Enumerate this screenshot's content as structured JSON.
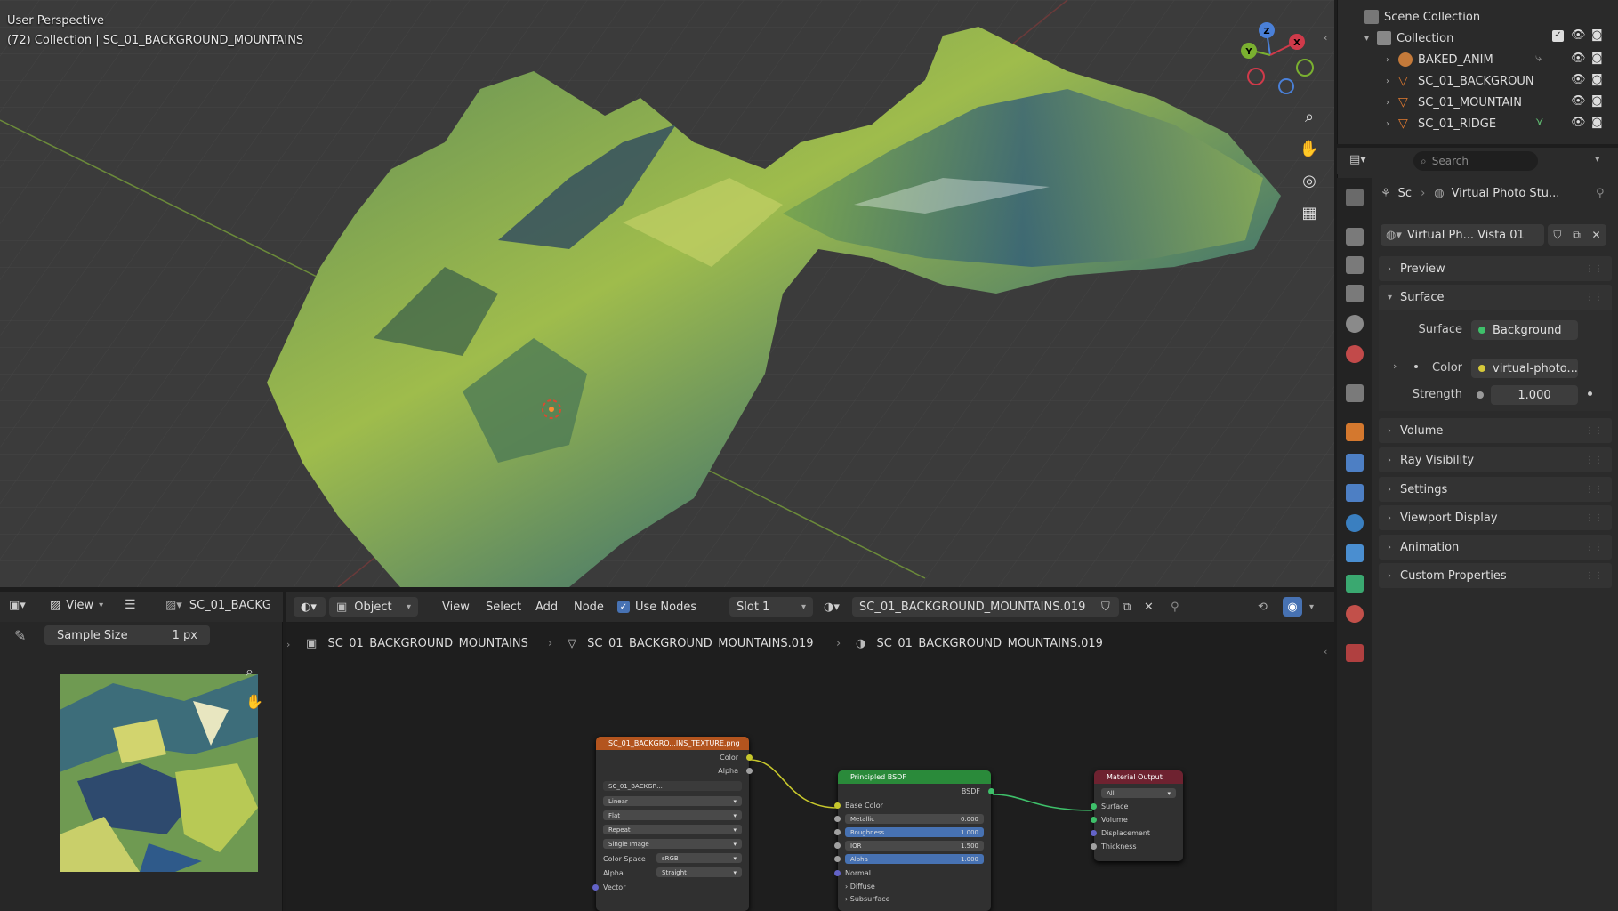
{
  "viewport": {
    "title": "User Perspective",
    "subtitle": "(72) Collection | SC_01_BACKGROUND_MOUNTAINS",
    "gizmo": {
      "z": "Z",
      "y": "Y",
      "x": "X"
    },
    "tools": [
      "zoom-icon",
      "hand-icon",
      "camera-icon",
      "grid-icon"
    ]
  },
  "outliner": {
    "root": "Scene Collection",
    "collection": "Collection",
    "items": [
      {
        "label": "BAKED_ANIM",
        "icon": "armature-icon"
      },
      {
        "label": "SC_01_BACKGROUN",
        "icon": "mesh-icon"
      },
      {
        "label": "SC_01_MOUNTAIN",
        "icon": "mesh-icon"
      },
      {
        "label": "SC_01_RIDGE",
        "icon": "mesh-icon"
      }
    ]
  },
  "properties": {
    "search_placeholder": "Search",
    "breadcrumb_scene": "Sc",
    "breadcrumb_world": "Virtual Photo Stu...",
    "world_name": "Virtual Ph... Vista 01",
    "panels": {
      "preview": "Preview",
      "surface": "Surface",
      "volume": "Volume",
      "ray_visibility": "Ray Visibility",
      "settings": "Settings",
      "viewport_display": "Viewport Display",
      "animation": "Animation",
      "custom_properties": "Custom Properties"
    },
    "surface_label": "Surface",
    "surface_value": "Background",
    "color_label": "Color",
    "color_value": "virtual-photo...",
    "strength_label": "Strength",
    "strength_value": "1.000",
    "accent": "#4772b3"
  },
  "image_editor": {
    "view": "View",
    "image_name": "SC_01_BACKG",
    "sample_size_label": "Sample Size",
    "sample_size_value": "1 px"
  },
  "node_header": {
    "mode": "Object",
    "menu": [
      "View",
      "Select",
      "Add",
      "Node"
    ],
    "use_nodes": "Use Nodes",
    "slot": "Slot 1",
    "material": "SC_01_BACKGROUND_MOUNTAINS.019"
  },
  "breadcrumb": {
    "object": "SC_01_BACKGROUND_MOUNTAINS",
    "mesh": "SC_01_BACKGROUND_MOUNTAINS.019",
    "material": "SC_01_BACKGROUND_MOUNTAINS.019"
  },
  "nodes": {
    "image_texture": {
      "title": "SC_01_BACKGRO...INS_TEXTURE.png",
      "out_color": "Color",
      "out_alpha": "Alpha",
      "image": "SC_01_BACKGR...",
      "interpolation": "Linear",
      "projection": "Flat",
      "extension": "Repeat",
      "source": "Single Image",
      "color_space_label": "Color Space",
      "color_space": "sRGB",
      "alpha_label": "Alpha",
      "alpha": "Straight",
      "vector": "Vector"
    },
    "principled": {
      "title": "Principled BSDF",
      "out": "BSDF",
      "base_color": "Base Color",
      "metallic_label": "Metallic",
      "metallic": "0.000",
      "roughness_label": "Roughness",
      "roughness": "1.000",
      "ior_label": "IOR",
      "ior": "1.500",
      "alpha_label": "Alpha",
      "alpha": "1.000",
      "normal": "Normal",
      "diffuse": "Diffuse",
      "subsurface": "Subsurface"
    },
    "output": {
      "title": "Material Output",
      "target": "All",
      "surface": "Surface",
      "volume": "Volume",
      "displacement": "Displacement",
      "thickness": "Thickness"
    }
  }
}
